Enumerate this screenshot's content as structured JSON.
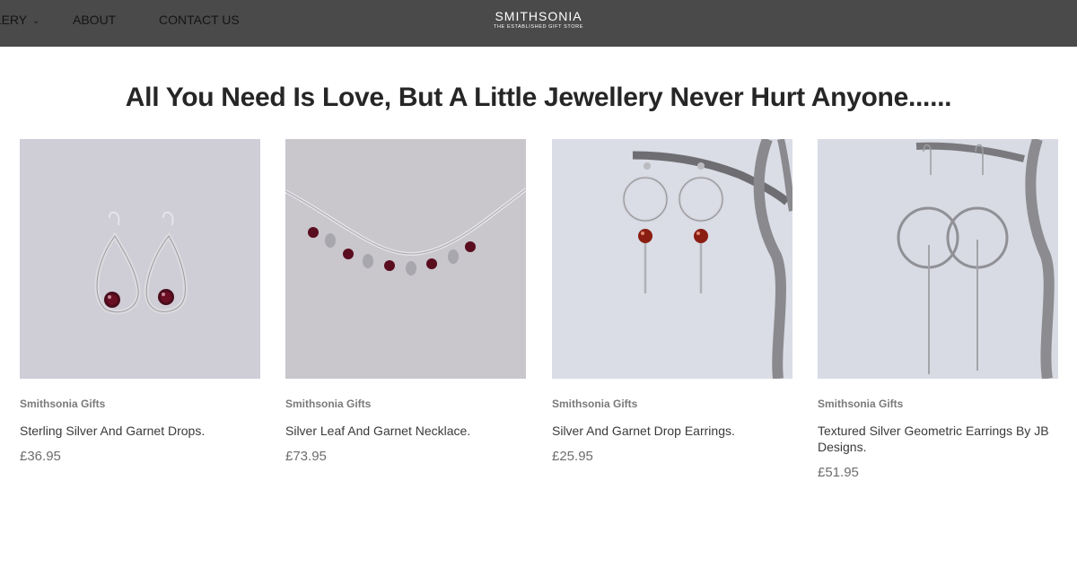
{
  "nav": {
    "items": [
      {
        "label": "LLERY",
        "has_dropdown": true
      },
      {
        "label": "ABOUT"
      },
      {
        "label": "CONTACT US"
      }
    ]
  },
  "brand": {
    "name": "SMITHSONIA",
    "tagline": "THE ESTABLISHED GIFT STORE"
  },
  "headline": "All You Need Is Love, But A Little Jewellery Never Hurt Anyone......",
  "products": [
    {
      "vendor": "Smithsonia Gifts",
      "title": "Sterling Silver And Garnet Drops.",
      "price": "£36.95"
    },
    {
      "vendor": "Smithsonia Gifts",
      "title": "Silver Leaf And Garnet Necklace.",
      "price": "£73.95"
    },
    {
      "vendor": "Smithsonia Gifts",
      "title": "Silver And Garnet Drop Earrings.",
      "price": "£25.95"
    },
    {
      "vendor": "Smithsonia Gifts",
      "title": "Textured Silver Geometric Earrings By JB Designs.",
      "price": "£51.95"
    }
  ],
  "colors": {
    "header_bg": "#4a4a4a",
    "garnet": "#6b0f24",
    "silver": "#c8c8c8"
  }
}
